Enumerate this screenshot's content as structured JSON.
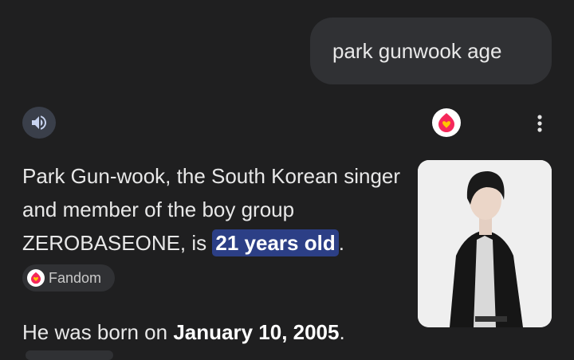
{
  "query": {
    "text": "park gunwook age"
  },
  "answer": {
    "part1": "Park Gun-wook, the South Korean singer and member of the boy group ZEROBASEONE, is ",
    "highlight": "21 years old",
    "part2": "."
  },
  "source_chip": {
    "label": "Fandom"
  },
  "born": {
    "prefix": "He was born on ",
    "date": "January 10, 2005",
    "suffix": "."
  },
  "icons": {
    "speaker": "speaker-icon",
    "fandom": "fandom-logo-icon",
    "more": "more-vert-icon"
  },
  "colors": {
    "background": "#1f1f20",
    "bubble": "#303134",
    "highlight": "#2c3f86",
    "fandom_brand": "#f5285a"
  }
}
